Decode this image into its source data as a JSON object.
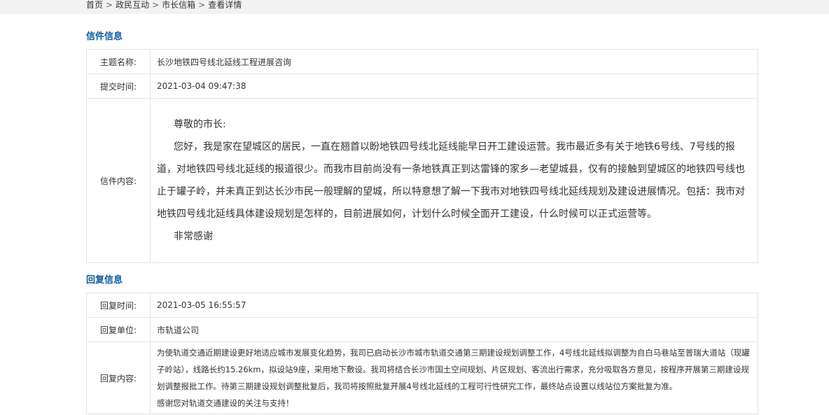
{
  "breadcrumb": {
    "home": "首页",
    "level2": "政民互动",
    "level3": "市长信箱",
    "current": "查看详情",
    "separator": ">"
  },
  "letter_section": {
    "title": "信件信息",
    "subject_label": "主题名称:",
    "subject": "长沙地铁四号线北延线工程进展咨询",
    "submit_time_label": "提交时间:",
    "submit_time": "2021-03-04 09:47:38",
    "content_label": "信件内容:",
    "content_paragraphs": [
      "尊敬的市长:",
      "您好，我是家在望城区的居民，一直在翘首以盼地铁四号线北延线能早日开工建设运营。我市最近多有关于地铁6号线、7号线的报道，对地铁四号线北延线的报道很少。而我市目前尚没有一条地铁真正到达雷锋的家乡—老望城县，仅有的接触到望城区的地铁四号线也止于罐子岭，并未真正到达长沙市民一般理解的望城，所以特意想了解一下我市对地铁四号线北延线规划及建设进展情况。包括：我市对地铁四号线北延线具体建设规划是怎样的，目前进展如何，计划什么时候全面开工建设，什么时候可以正式运营等。",
      "非常感谢"
    ]
  },
  "reply_section": {
    "title": "回复信息",
    "reply_time_label": "回复时间:",
    "reply_time": "2021-03-05 16:55:57",
    "reply_unit_label": "回复单位:",
    "reply_unit": "市轨道公司",
    "reply_content_label": "回复内容:",
    "reply_paragraphs": [
      "为使轨道交通近期建设更好地适应城市发展变化趋势，我司已启动长沙市城市轨道交通第三期建设规划调整工作，4号线北延线拟调整为自白马巷站至普瑞大道站（现罐子岭站），线路长约15.26km，拟设站9座，采用地下敷设。我司将结合长沙市国土空间规划、片区规划、客流出行需求，充分吸取各方意见，按程序开展第三期建设规划调整报批工作。待第三期建设规划调整批复后，我司将按照批复开展4号线北延线的工程可行性研究工作，最终站点设置以线站位方案批复为准。",
      "感谢您对轨道交通建设的关注与支持！"
    ]
  }
}
